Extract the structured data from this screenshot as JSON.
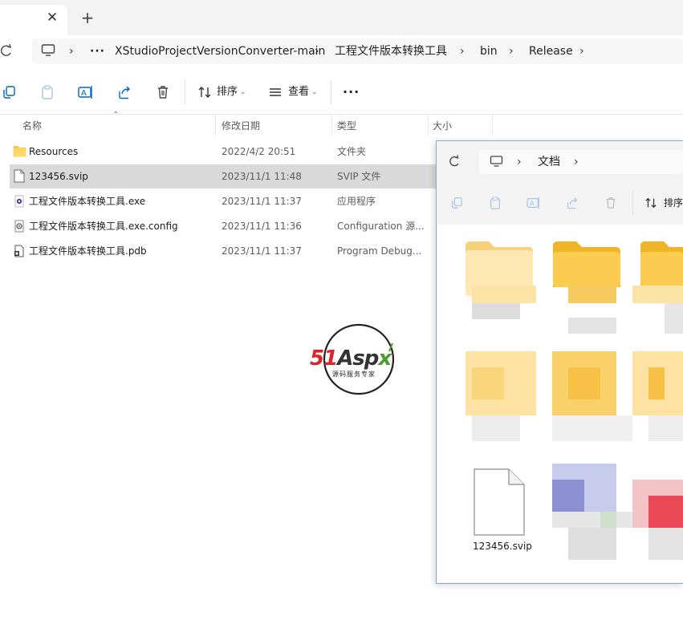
{
  "tab": {
    "close_glyph": "✕",
    "new_glyph": "+"
  },
  "address": {
    "crumbs": [
      "XStudioProjectVersionConverter-main",
      "工程文件版本转换工具",
      "bin",
      "Release"
    ],
    "more_glyph": "···",
    "sep_glyph": "›"
  },
  "toolbar": {
    "sort_label": "排序",
    "view_label": "查看",
    "more_glyph": "···"
  },
  "columns": {
    "name": "名称",
    "date": "修改日期",
    "type": "类型",
    "size": "大小"
  },
  "files": [
    {
      "name": "Resources",
      "date": "2022/4/2 20:51",
      "type": "文件夹",
      "icon": "folder-icon"
    },
    {
      "name": "123456.svip",
      "date": "2023/11/1 11:48",
      "type": "SVIP 文件",
      "icon": "file-icon"
    },
    {
      "name": "工程文件版本转换工具.exe",
      "date": "2023/11/1 11:37",
      "type": "应用程序",
      "icon": "app-icon"
    },
    {
      "name": "工程文件版本转换工具.exe.config",
      "date": "2023/11/1 11:36",
      "type": "Configuration 源...",
      "icon": "config-icon"
    },
    {
      "name": "工程文件版本转换工具.pdb",
      "date": "2023/11/1 11:37",
      "type": "Program Debug...",
      "icon": "pdb-icon"
    }
  ],
  "watermark": {
    "brand": "51Aspx",
    "tagline": "源码服务专家"
  },
  "window2": {
    "crumb": "文档",
    "sort_label": "排序",
    "file_label": "123456.svip"
  },
  "colors": {
    "accent": "#0067c0",
    "folder": "#f8c84a",
    "selected_row": "#d9d9d9"
  }
}
